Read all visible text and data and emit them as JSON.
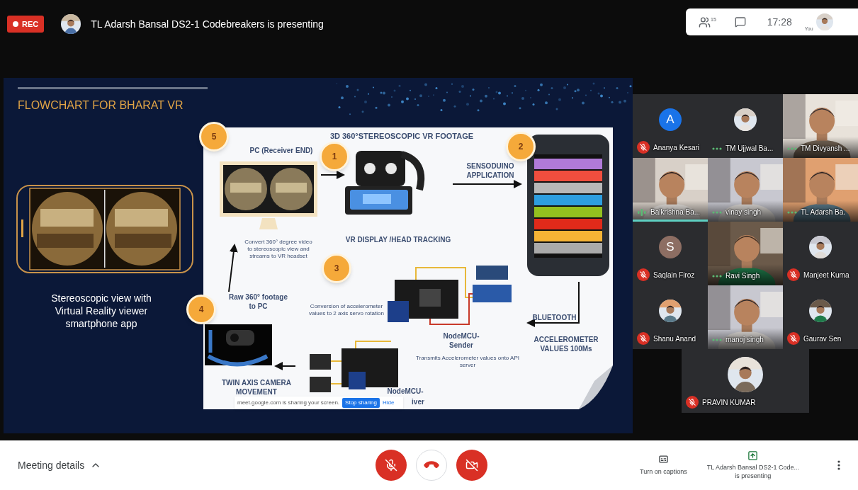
{
  "top_bar": {
    "recording": "REC",
    "presenter_text": "TL Adarsh Bansal DS2-1 Codebreakers is presenting",
    "participant_count": "15",
    "time": "17:28",
    "self_label": "You"
  },
  "slide": {
    "title": "FLOWCHART FOR BHARAT VR",
    "caption": "Stereoscopic view with Virtual Reality viewer smartphone app",
    "flowchart": {
      "labels": [
        {
          "text": "3D 360°STEREOSCOPIC VR FOOTAGE",
          "kind": "heading"
        },
        {
          "text": "PC (Receiver END)",
          "kind": "bold"
        },
        {
          "text": "Convert 360° degree video to stereoscopic view and streams to VR headset",
          "kind": "note"
        },
        {
          "text": "VR DISPLAY /HEAD TRACKING",
          "kind": "bold"
        },
        {
          "text": "SENSODUINO APPLICATION",
          "kind": "bold"
        },
        {
          "text": "Raw 360° footage to PC",
          "kind": "bold"
        },
        {
          "text": "Conversion of accelerometer values to 2 axis servo rotation",
          "kind": "note"
        },
        {
          "text": "BLUETOOTH",
          "kind": "bold"
        },
        {
          "text": "NodeMCU-Sender",
          "kind": "bold"
        },
        {
          "text": "ACCELEROMETER VALUES 100Ms",
          "kind": "bold"
        },
        {
          "text": "Transmits Accelerometer values onto API server",
          "kind": "note"
        },
        {
          "text": "TWIN AXIS CAMERA MOVEMENT",
          "kind": "bold"
        },
        {
          "text": "NodeMCU-",
          "kind": "bold"
        },
        {
          "text": "iver",
          "kind": "bold"
        }
      ],
      "steps": [
        "5",
        "1",
        "2",
        "3",
        "4"
      ]
    },
    "share_notice": {
      "message": "meet.google.com is sharing your screen.",
      "stop_button": "Stop sharing",
      "hide_link": "Hide"
    }
  },
  "participants": [
    {
      "name": "Ananya Kesari",
      "kind": "letter",
      "letter": "A",
      "color": "#1a73e8",
      "muted": true,
      "speaking": false
    },
    {
      "name": "TM Ujjwal Ba...",
      "muted": false,
      "speaking": false
    },
    {
      "name": "TM Divyansh ...",
      "kind": "video",
      "muted": false,
      "speaking": false
    },
    {
      "name": "Balkrishna Ba...",
      "kind": "video",
      "muted": false,
      "speaking": true
    },
    {
      "name": "vinay singh",
      "kind": "video",
      "muted": false,
      "speaking": false
    },
    {
      "name": "TL Adarsh Ba.",
      "kind": "video",
      "muted": false,
      "speaking": false
    },
    {
      "name": "Saqlain Firoz",
      "kind": "letter",
      "letter": "S",
      "color": "#8d6e63",
      "muted": true,
      "speaking": false
    },
    {
      "name": "Ravi Singh",
      "kind": "video",
      "muted": false,
      "speaking": false
    },
    {
      "name": "Manjeet Kuma",
      "muted": true,
      "speaking": false
    },
    {
      "name": "Shanu Anand",
      "muted": true,
      "speaking": false
    },
    {
      "name": "manoj singh",
      "kind": "video",
      "muted": false,
      "speaking": false
    },
    {
      "name": "Gaurav Sen",
      "muted": true,
      "speaking": false
    },
    {
      "name": "PRAVIN KUMAR",
      "muted": true,
      "speaking": false
    }
  ],
  "bottom_bar": {
    "meeting_details": "Meeting details",
    "mic_on": false,
    "camera_on": false,
    "captions_label": "Turn on captions",
    "presenting_lines": [
      "TL Adarsh Bansal DS2-1 Code...",
      "is presenting"
    ]
  }
}
